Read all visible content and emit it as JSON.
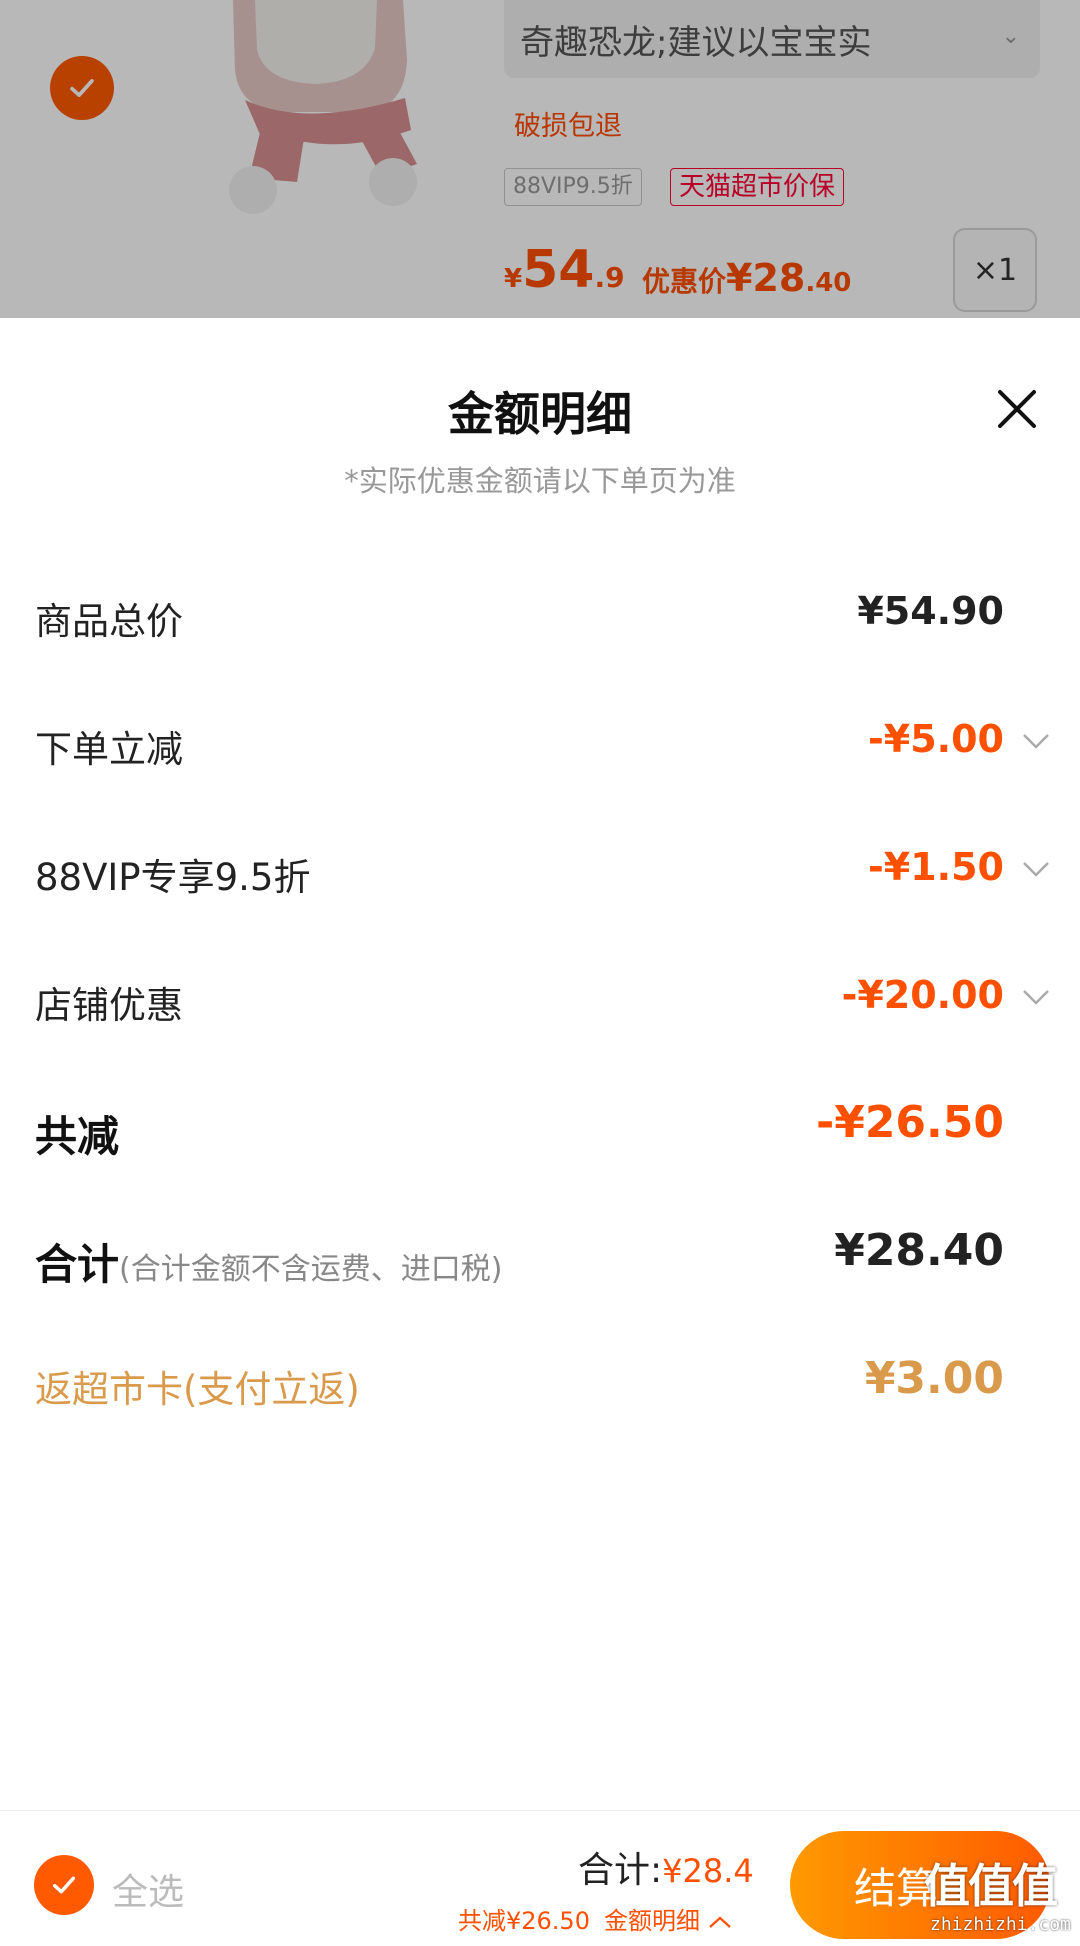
{
  "product": {
    "variant": "奇趣恐龙;建议以宝宝实",
    "damage_note": "破损包退",
    "tags": [
      "88VIP9.5折",
      "天猫超市价保"
    ],
    "price_yen": "¥",
    "price_int": "54",
    "price_dec": ".9",
    "promo_label": "优惠价",
    "promo_value": "¥28",
    "promo_dec": ".40",
    "quantity": "×1"
  },
  "sheet": {
    "title": "金额明细",
    "note": "*实际优惠金额请以下单页为准",
    "rows": [
      {
        "label": "商品总价",
        "amount": "¥54.90"
      },
      {
        "label": "下单立减",
        "amount": "-¥5.00"
      },
      {
        "label": "88VIP专享9.5折",
        "amount": "-¥1.50"
      },
      {
        "label": "店铺优惠",
        "amount": "-¥20.00"
      },
      {
        "label": "共减",
        "amount": "-¥26.50"
      },
      {
        "label": "合计",
        "sublabel": "(合计金额不含运费、进口税)",
        "amount": "¥28.40"
      },
      {
        "label": "返超市卡(支付立返)",
        "amount": "¥3.00"
      }
    ]
  },
  "bottom_bar": {
    "select_all": "全选",
    "total_label": "合计:",
    "total_value": "¥28.4",
    "savings": "共减¥26.50",
    "detail_link": "金额明细",
    "checkout": "结算"
  },
  "watermark": {
    "text": "值值值",
    "url": "zhizhizhi.com"
  },
  "colors": {
    "accent": "#ff5000",
    "gold": "#d99a4c",
    "tmall_red": "#ff0036"
  }
}
